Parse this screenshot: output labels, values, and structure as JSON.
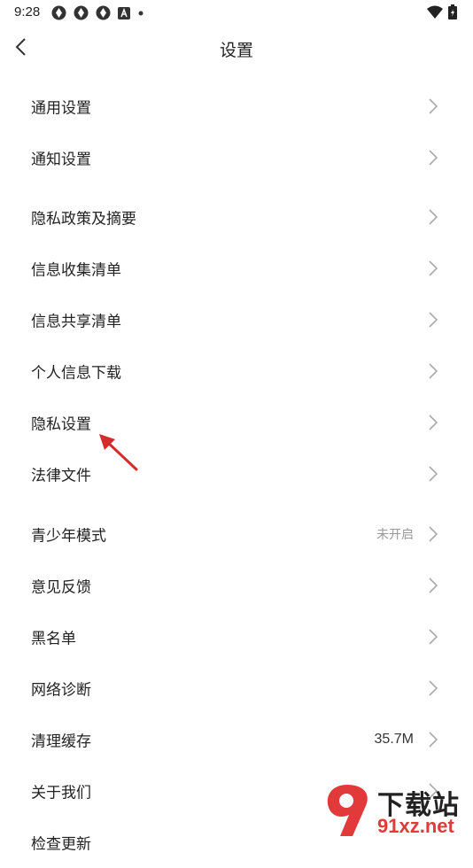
{
  "status_bar": {
    "time": "9:28",
    "icons": [
      "app-icon",
      "app-icon",
      "app-icon",
      "a-icon",
      "dot-icon",
      "wifi-icon",
      "battery-icon"
    ]
  },
  "header": {
    "title": "设置",
    "back_icon": "chevron-left-icon"
  },
  "settings": {
    "items": [
      {
        "label": "通用设置",
        "value": ""
      },
      {
        "label": "通知设置",
        "value": ""
      },
      {
        "label": "隐私政策及摘要",
        "value": ""
      },
      {
        "label": "信息收集清单",
        "value": ""
      },
      {
        "label": "信息共享清单",
        "value": ""
      },
      {
        "label": "个人信息下载",
        "value": ""
      },
      {
        "label": "隐私设置",
        "value": ""
      },
      {
        "label": "法律文件",
        "value": ""
      },
      {
        "label": "青少年模式",
        "value": "未开启"
      },
      {
        "label": "意见反馈",
        "value": ""
      },
      {
        "label": "黑名单",
        "value": ""
      },
      {
        "label": "网络诊断",
        "value": ""
      },
      {
        "label": "清理缓存",
        "value": "35.7M"
      },
      {
        "label": "关于我们",
        "value": ""
      },
      {
        "label": "检查更新",
        "value": ""
      }
    ]
  },
  "annotation": {
    "icon": "red-arrow-icon",
    "color": "#d42b2b"
  },
  "watermark": {
    "title": "下载站",
    "domain": "91xz.net",
    "accent": "#e23a3a"
  }
}
